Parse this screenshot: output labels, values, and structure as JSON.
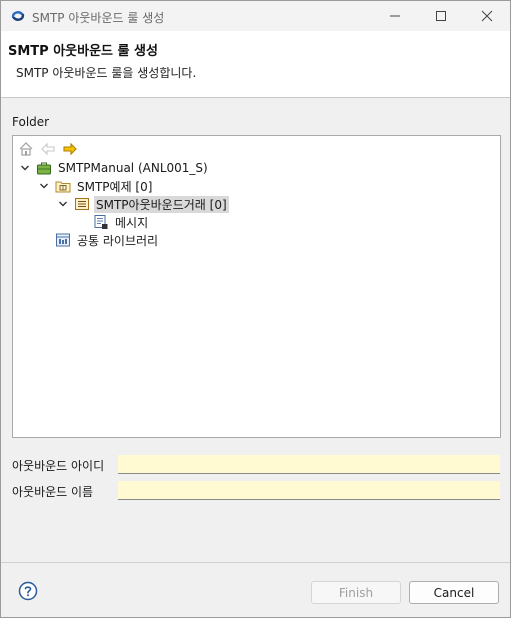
{
  "window": {
    "title": "SMTP 아웃바운드 룰 생성"
  },
  "banner": {
    "title": "SMTP 아웃바운드 룰 생성",
    "description": "SMTP 아웃바운드 룰을 생성합니다."
  },
  "folder": {
    "label": "Folder",
    "tree": [
      {
        "label": "SMTPManual  (ANL001_S)",
        "icon": "project-briefcase-icon",
        "expanded": true,
        "level": 0
      },
      {
        "label": "SMTP예제 [0]",
        "icon": "folder-package-icon",
        "expanded": true,
        "level": 1
      },
      {
        "label": "SMTP아웃바운드거래 [0]",
        "icon": "transaction-icon",
        "expanded": true,
        "level": 2,
        "selected": true
      },
      {
        "label": "메시지",
        "icon": "message-document-icon",
        "level": 3
      },
      {
        "label": "공통 라이브러리",
        "icon": "library-icon",
        "level": 1
      }
    ]
  },
  "fields": {
    "outbound_id_label": "아웃바운드 아이디",
    "outbound_id_value": "",
    "outbound_name_label": "아웃바운드 이름",
    "outbound_name_value": ""
  },
  "buttons": {
    "finish": "Finish",
    "cancel": "Cancel"
  },
  "colors": {
    "input_required_bg": "#fffad2",
    "selection_bg": "#d9d9d9",
    "nav_arrow": "#e8a800"
  }
}
